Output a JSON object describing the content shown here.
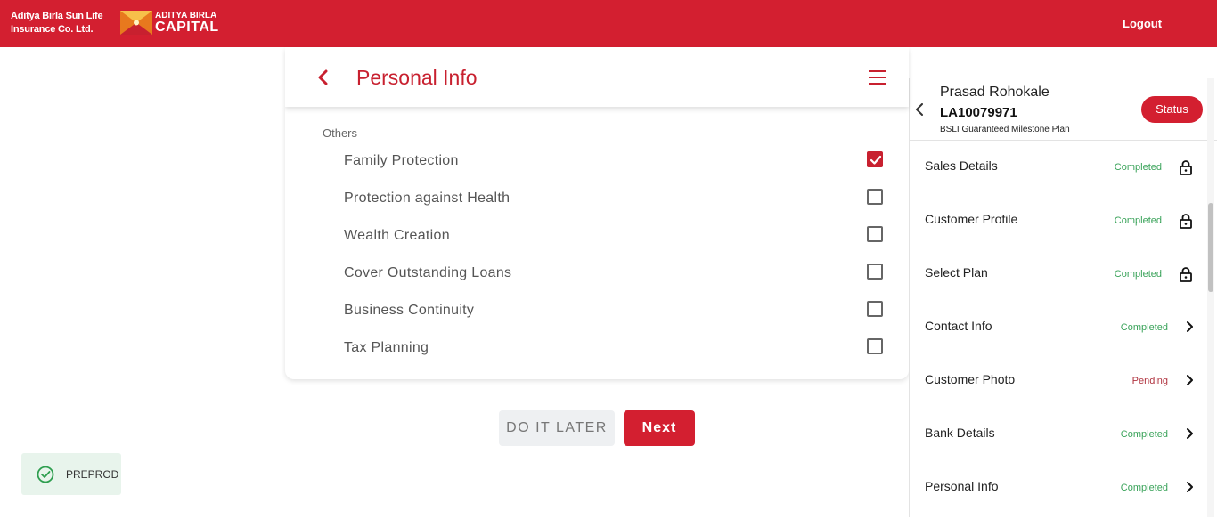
{
  "header": {
    "brand_line1": "Aditya Birla Sun Life",
    "brand_line2": "Insurance Co. Ltd.",
    "logo_line1": "ADITYA BIRLA",
    "logo_line2": "CAPITAL",
    "logout_label": "Logout",
    "brand_color": "#d31f30"
  },
  "page": {
    "title": "Personal Info",
    "section_label": "Others",
    "options": [
      {
        "label": "Family Protection",
        "checked": true
      },
      {
        "label": "Protection against Health",
        "checked": false
      },
      {
        "label": "Wealth Creation",
        "checked": false
      },
      {
        "label": "Cover Outstanding Loans",
        "checked": false
      },
      {
        "label": "Business Continuity",
        "checked": false
      },
      {
        "label": "Tax Planning",
        "checked": false
      }
    ],
    "do_it_later_label": "DO IT LATER",
    "next_label": "Next"
  },
  "env_badge": {
    "label": "PREPROD"
  },
  "side_panel": {
    "customer_name": "Prasad Rohokale",
    "application_id": "LA10079971",
    "plan_name": "BSLI Guaranteed Milestone Plan",
    "status_button": "Status",
    "steps": [
      {
        "label": "Sales Details",
        "status": "Completed",
        "icon": "lock-icon"
      },
      {
        "label": "Customer Profile",
        "status": "Completed",
        "icon": "lock-icon"
      },
      {
        "label": "Select Plan",
        "status": "Completed",
        "icon": "lock-icon"
      },
      {
        "label": "Contact Info",
        "status": "Completed",
        "icon": "chevron-right-icon"
      },
      {
        "label": "Customer Photo",
        "status": "Pending",
        "icon": "chevron-right-icon"
      },
      {
        "label": "Bank Details",
        "status": "Completed",
        "icon": "chevron-right-icon"
      },
      {
        "label": "Personal Info",
        "status": "Completed",
        "icon": "chevron-right-icon"
      }
    ],
    "status_colors": {
      "Completed": "#3aa35a",
      "Pending": "#b0333f"
    }
  }
}
